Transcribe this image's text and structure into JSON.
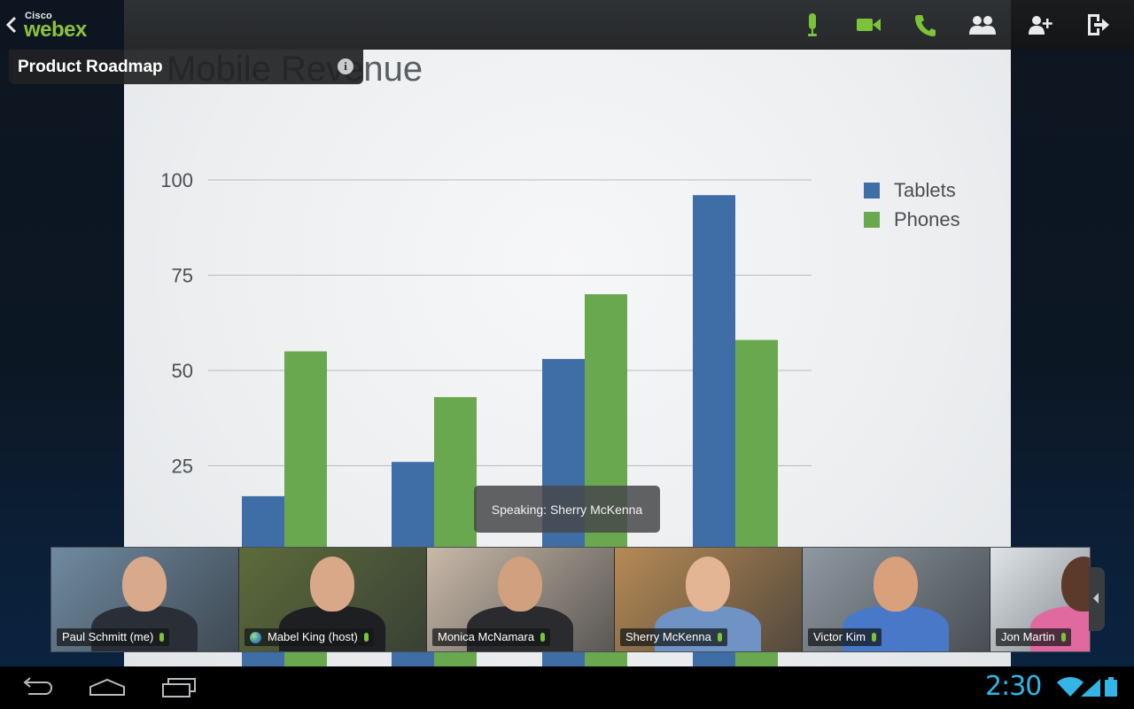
{
  "app": {
    "brand_top": "Cisco",
    "brand_main": "webex",
    "meeting_title": "Product Roadmap",
    "info_icon_glyph": "i"
  },
  "toolbar": {
    "icons": [
      "microphone-icon",
      "video-camera-icon",
      "phone-icon",
      "participants-icon",
      "add-participant-icon",
      "leave-meeting-icon"
    ],
    "accent": "#7bc43a"
  },
  "slide": {
    "title": "Mobile Revenue"
  },
  "chart_data": {
    "type": "bar",
    "title": "Mobile Revenue",
    "categories": [
      "",
      "",
      "",
      ""
    ],
    "series": [
      {
        "name": "Tablets",
        "color": "#3e6ea5",
        "values": [
          17,
          26,
          53,
          96
        ]
      },
      {
        "name": "Phones",
        "color": "#6aa84f",
        "values": [
          55,
          43,
          70,
          58
        ]
      }
    ],
    "y_ticks": [
      "100",
      "75",
      "50",
      "25"
    ],
    "ylim": [
      0,
      100
    ],
    "grid": true,
    "legend": "top-right"
  },
  "speaking": {
    "text": "Speaking: Sherry McKenna"
  },
  "participants": [
    {
      "name": "Paul Schmitt (me)",
      "bg": "#6f8aa0",
      "skin": "#d8a98a",
      "suit": "#2a2e36"
    },
    {
      "name": "Mabel King (host)",
      "bg": "#5d6b3a",
      "skin": "#d9a889",
      "suit": "#1e1f22"
    },
    {
      "name": "Monica McNamara",
      "bg": "#c9b9a8",
      "skin": "#d0a07f",
      "suit": "#2a2b2e"
    },
    {
      "name": "Sherry McKenna",
      "bg": "#b68a55",
      "skin": "#e3b595",
      "suit": "#6e93c4"
    },
    {
      "name": "Victor Kim",
      "bg": "#8f99a2",
      "skin": "#d9a07c",
      "suit": "#4a78c9"
    },
    {
      "name": "Jon Martin",
      "bg": "#dfe4e8",
      "skin": "#5b3a2a",
      "suit": "#e06aa0"
    }
  ],
  "system": {
    "time": "2:30",
    "nav_icons": [
      "back-icon",
      "home-icon",
      "recent-apps-icon"
    ],
    "status_icons": [
      "wifi-icon",
      "signal-icon",
      "battery-icon"
    ],
    "accent": "#33b5e5"
  }
}
